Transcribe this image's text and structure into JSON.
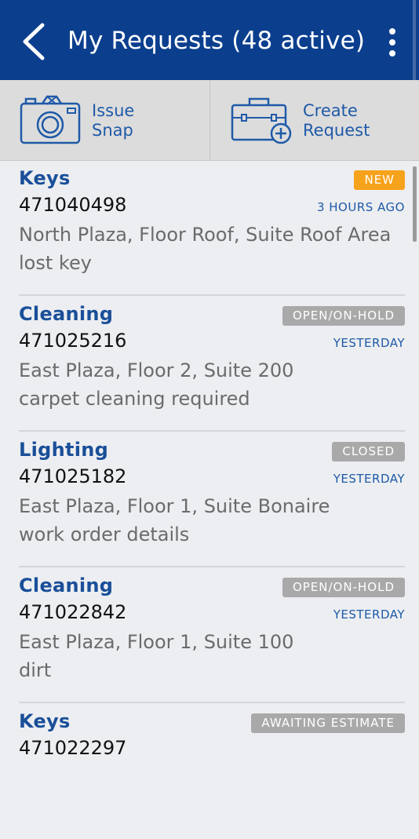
{
  "header": {
    "title": "My Requests (48 active)",
    "background": "#0b3f8e"
  },
  "actions": {
    "snap": {
      "line1": "Issue",
      "line2": "Snap",
      "icon": "camera-icon"
    },
    "create": {
      "line1": "Create",
      "line2": "Request",
      "icon": "toolbox-add-icon"
    }
  },
  "requests": [
    {
      "category": "Keys",
      "number": "471040498",
      "status": "NEW",
      "status_color": "#f7a21b",
      "time": "3 HOURS AGO",
      "location": "North Plaza, Floor Roof, Suite Roof Area",
      "description": "lost key"
    },
    {
      "category": "Cleaning",
      "number": "471025216",
      "status": "OPEN/ON-HOLD",
      "status_color": "#a9a9a9",
      "time": "YESTERDAY",
      "location": "East Plaza, Floor 2, Suite 200",
      "description": "carpet cleaning required"
    },
    {
      "category": "Lighting",
      "number": "471025182",
      "status": "CLOSED",
      "status_color": "#a9a9a9",
      "time": "YESTERDAY",
      "location": "East Plaza, Floor 1, Suite Bonaire",
      "description": "work order details"
    },
    {
      "category": "Cleaning",
      "number": "471022842",
      "status": "OPEN/ON-HOLD",
      "status_color": "#a9a9a9",
      "time": "YESTERDAY",
      "location": "East Plaza, Floor 1, Suite 100",
      "description": "dirt"
    },
    {
      "category": "Keys",
      "number": "471022297",
      "status": "AWAITING ESTIMATE",
      "status_color": "#a9a9a9",
      "time": "",
      "location": "",
      "description": ""
    }
  ]
}
